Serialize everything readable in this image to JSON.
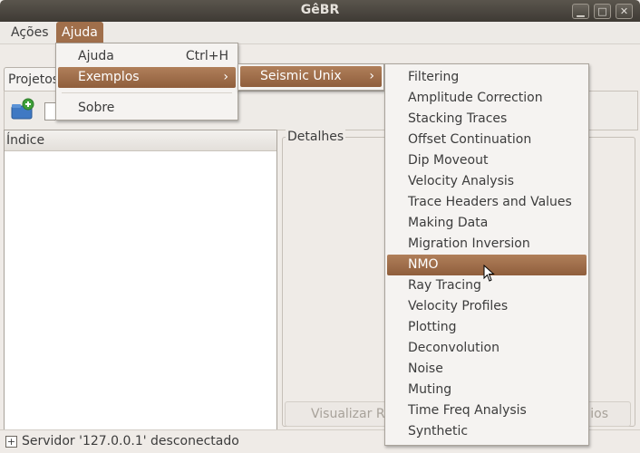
{
  "window": {
    "title": "GêBR"
  },
  "menubar": {
    "items": [
      "Ações",
      "Ajuda"
    ]
  },
  "tabs": {
    "projects": "Projetos"
  },
  "left_pane": {
    "header": "Índice"
  },
  "right_pane": {
    "header": "Detalhes",
    "button_left": "Visualizar Re",
    "button_right": "ios"
  },
  "help_menu": {
    "ajuda": "Ajuda",
    "ajuda_shortcut": "Ctrl+H",
    "exemplos": "Exemplos",
    "sobre": "Sobre"
  },
  "examples_menu": {
    "seismic_unix": "Seismic Unix"
  },
  "seismic_unix_menu": {
    "items": [
      "Filtering",
      "Amplitude Correction",
      "Stacking Traces",
      "Offset Continuation",
      "Dip Moveout",
      "Velocity Analysis",
      "Trace Headers and Values",
      "Making Data",
      "Migration Inversion",
      "NMO",
      "Ray Tracing",
      "Velocity Profiles",
      "Plotting",
      "Deconvolution",
      "Noise",
      "Muting",
      "Time Freq Analysis",
      "Synthetic"
    ],
    "highlighted": "NMO"
  },
  "status": {
    "text": "Servidor '127.0.0.1' desconectado"
  }
}
